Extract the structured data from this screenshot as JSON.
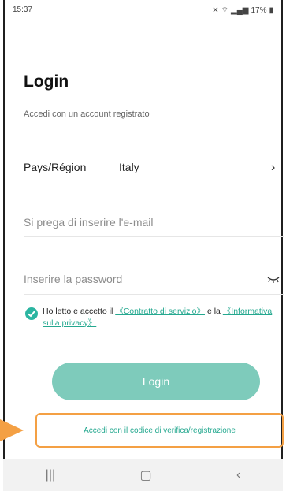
{
  "status_bar": {
    "time": "15:37",
    "battery": "17%"
  },
  "page": {
    "title": "Login",
    "subtitle": "Accedi con un account registrato"
  },
  "form": {
    "country_label": "Pays/Région",
    "country_value": "Italy",
    "email_placeholder": "Si prega di inserire l'e-mail",
    "password_placeholder": "Inserire la password"
  },
  "consent": {
    "checked": true,
    "text_before": "Ho letto e accetto il",
    "contract_link": "《Contratto di servizio》",
    "text_middle": "e la",
    "privacy_link": "《Informativa sulla privacy》"
  },
  "actions": {
    "login_label": "Login",
    "code_login_label": "Accedi con il codice di verifica/registrazione"
  },
  "navbar": {
    "recent_icon": "recent-apps-icon",
    "home_icon": "home-icon",
    "back_icon": "back-icon"
  },
  "colors": {
    "accent": "#2bb5a1",
    "login_button": "#7ecbbb",
    "highlight": "#f4a044",
    "link": "#24a88f"
  }
}
